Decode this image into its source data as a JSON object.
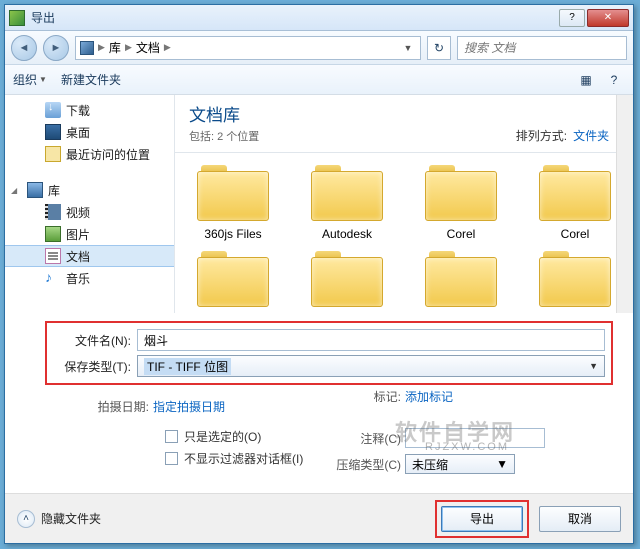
{
  "title": "导出",
  "nav": {
    "back": "◄",
    "fwd": "►"
  },
  "breadcrumb": {
    "root_icon": true,
    "seg1": "库",
    "seg2": "文档"
  },
  "refresh": "↻",
  "search": {
    "placeholder": "搜索 文档"
  },
  "toolbar": {
    "organize": "组织",
    "newfolder": "新建文件夹",
    "view": "▦",
    "help": "?"
  },
  "sidebar": {
    "downloads": "下载",
    "desktop": "桌面",
    "recent": "最近访问的位置",
    "library": "库",
    "videos": "视频",
    "pictures": "图片",
    "documents": "文档",
    "music": "音乐",
    "music_icon": "♪"
  },
  "content": {
    "title": "文档库",
    "subtitle": "包括: 2 个位置",
    "sort_label": "排列方式:",
    "sort_value": "文件夹",
    "folders": [
      "360js Files",
      "Autodesk",
      "Corel",
      "Corel"
    ]
  },
  "inputs": {
    "filename_label": "文件名(N):",
    "filename_value": "烟斗",
    "filetype_label": "保存类型(T):",
    "filetype_value": "TIF - TIFF 位图"
  },
  "meta": {
    "shootdate_label": "拍摄日期:",
    "shootdate_value": "指定拍摄日期",
    "tags_label": "标记:",
    "tags_value": "添加标记",
    "only_selected": "只是选定的(O)",
    "no_filter": "不显示过滤器对话框(I)",
    "comment_label": "注释(C)",
    "compress_label": "压缩类型(C)",
    "compress_value": "未压缩"
  },
  "footer": {
    "hide": "隐藏文件夹",
    "export": "导出",
    "cancel": "取消"
  },
  "watermark": {
    "main": "软件自学网",
    "sub": "RJZXW.COM"
  }
}
